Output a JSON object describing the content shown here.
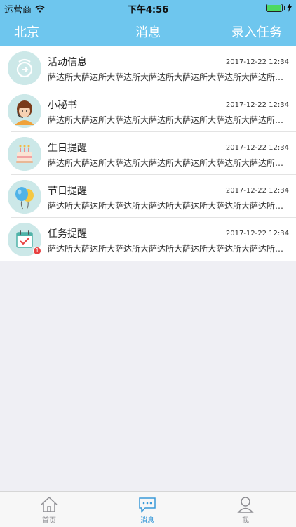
{
  "status_bar": {
    "carrier": "运营商",
    "time": "下午4:56"
  },
  "nav": {
    "left": "北京",
    "title": "消息",
    "right": "录入任务"
  },
  "messages": [
    {
      "title": "活动信息",
      "time": "2017-12-22 12:34",
      "preview": "萨达所大萨达所大萨达所大萨达所大萨达所大萨达所大萨达所大萨达所大萨达",
      "icon": "activity-icon"
    },
    {
      "title": "小秘书",
      "time": "2017-12-22 12:34",
      "preview": "萨达所大萨达所大萨达所大萨达所大萨达所大萨达所大萨达所大萨达所大萨达",
      "icon": "secretary-icon"
    },
    {
      "title": "生日提醒",
      "time": "2017-12-22 12:34",
      "preview": "萨达所大萨达所大萨达所大萨达所大萨达所大萨达所大萨达所大萨达所大萨达",
      "icon": "birthday-cake-icon"
    },
    {
      "title": "节日提醒",
      "time": "2017-12-22 12:34",
      "preview": "萨达所大萨达所大萨达所大萨达所大萨达所大萨达所大萨达所大萨达所大萨达",
      "icon": "balloon-icon"
    },
    {
      "title": "任务提醒",
      "time": "2017-12-22 12:34",
      "preview": "萨达所大萨达所大萨达所大萨达所大萨达所大萨达所大萨达所大萨达所大萨达",
      "icon": "calendar-check-icon",
      "badge": "1"
    }
  ],
  "tabs": [
    {
      "label": "首页",
      "icon": "home-icon",
      "active": false
    },
    {
      "label": "消息",
      "icon": "message-icon",
      "active": true
    },
    {
      "label": "我",
      "icon": "user-icon",
      "active": false
    }
  ],
  "colors": {
    "accent": "#6ec6ee",
    "tab_active": "#3a9ad9",
    "badge": "#e84141"
  }
}
